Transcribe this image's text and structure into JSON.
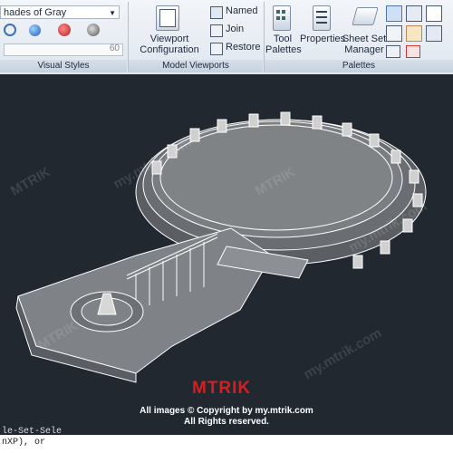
{
  "visual_style": {
    "value": "hades of Gray",
    "panel_title": "Visual Styles",
    "slider_value": "60"
  },
  "model_viewports": {
    "panel_title": "Model Viewports",
    "viewport_config_label": "Viewport\nConfiguration",
    "named_label": "Named",
    "join_label": "Join",
    "restore_label": "Restore"
  },
  "palettes": {
    "panel_title": "Palettes",
    "tool_palettes_label": "Tool\nPalettes",
    "properties_label": "Properties",
    "sheet_set_label": "Sheet Set\nManager"
  },
  "watermark": {
    "brand": "MTRIK",
    "site": "my.mtrik.com",
    "copyright_line1": "All images © Copyright by my.mtrik.com",
    "copyright_line2": "All Rights reserved."
  },
  "command_line": {
    "text": "nXP), or",
    "text2": "le-Set-Sele"
  },
  "colors": {
    "viewport_bg": "#212830",
    "model_fill": "#7f8286",
    "logo_red": "#d51f1f"
  },
  "icons": [
    "viewport-configuration-icon",
    "named-viewports-icon",
    "join-icon",
    "restore-icon",
    "tool-palettes-icon",
    "properties-icon",
    "sheet-set-manager-icon"
  ]
}
